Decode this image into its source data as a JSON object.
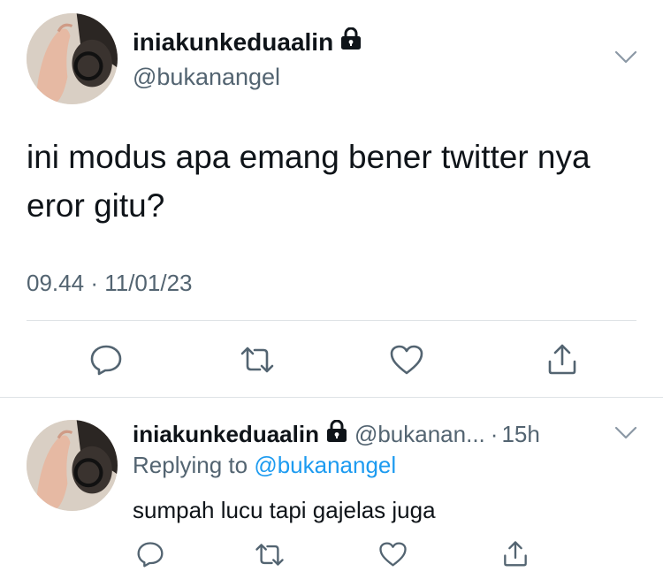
{
  "tweet": {
    "display_name": "iniakunkeduaalin",
    "handle": "@bukanangel",
    "text": "ini modus apa emang bener twitter nya eror gitu?",
    "time": "09.44",
    "separator": "·",
    "date": "11/01/23",
    "icons": {
      "lock": "lock-icon",
      "more": "chevron-down-icon",
      "reply": "reply-icon",
      "retweet": "retweet-icon",
      "like": "heart-icon",
      "share": "share-icon"
    }
  },
  "reply": {
    "display_name": "iniakunkeduaalin",
    "handle": "@bukanan...",
    "separator": "·",
    "time_ago": "15h",
    "replying_prefix": "Replying to",
    "replying_to": "@bukanangel",
    "text": "sumpah lucu tapi gajelas juga"
  },
  "colors": {
    "text": "#0f1419",
    "secondary": "#536471",
    "link": "#1d9bf0",
    "divider": "#dfe3e6"
  }
}
